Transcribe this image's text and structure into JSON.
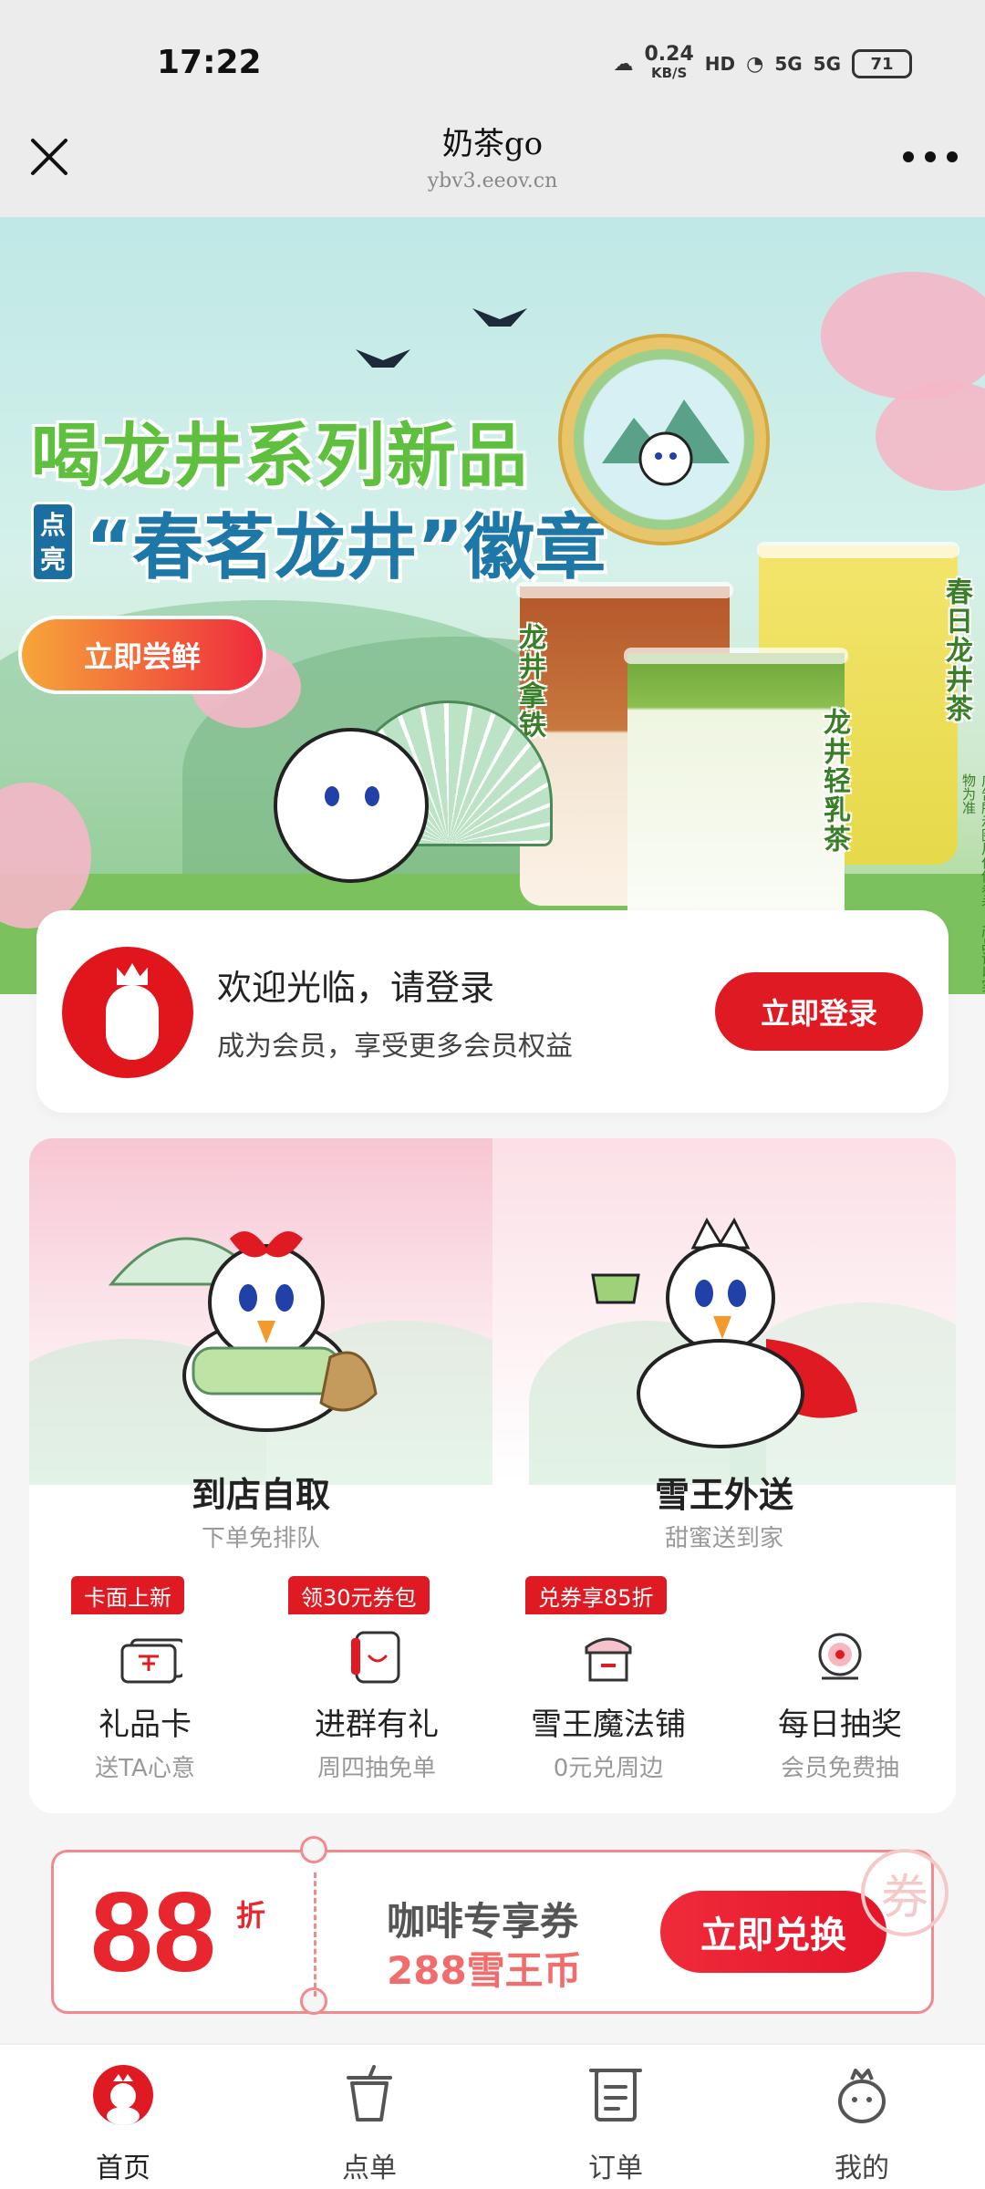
{
  "status_bar": {
    "time": "17:22",
    "net_speed_value": "0.24",
    "net_speed_unit": "KB/S",
    "hd": "HD",
    "signal1": "5G",
    "signal2": "5G",
    "battery": "71"
  },
  "nav": {
    "title": "奶茶go",
    "url": "ybv3.eeov.cn",
    "close_icon": "close-icon",
    "more_icon": "more-icon"
  },
  "banner": {
    "headline_line1": "喝龙井系列新品",
    "headline_tag": "点亮",
    "headline_line2": "“春茗龙井”徽章",
    "cta": "立即尝鲜",
    "drink1": "龙井拿铁",
    "drink2": "龙井轻乳茶",
    "drink3": "春日龙井茶",
    "ad_note": "广告所示图片仅供参考，产品请以实物为准"
  },
  "login": {
    "title": "欢迎光临，请登录",
    "subtitle": "成为会员，享受更多会员权益",
    "button": "立即登录"
  },
  "services": {
    "pickup": {
      "title": "到店自取",
      "subtitle": "下单免排队"
    },
    "delivery": {
      "title": "雪王外送",
      "subtitle": "甜蜜送到家"
    }
  },
  "features": [
    {
      "tag": "卡面上新",
      "label": "礼品卡",
      "sub": "送TA心意",
      "icon": "gift-card-icon"
    },
    {
      "tag": "领30元券包",
      "label": "进群有礼",
      "sub": "周四抽免单",
      "icon": "group-chat-icon"
    },
    {
      "tag": "兑券享85折",
      "label": "雪王魔法铺",
      "sub": "0元兑周边",
      "icon": "shop-icon"
    },
    {
      "tag": "",
      "label": "每日抽奖",
      "sub": "会员免费抽",
      "icon": "lottery-icon"
    }
  ],
  "coupon": {
    "discount": "88",
    "unit": "折",
    "title": "咖啡专享券",
    "cost": "288雪王币",
    "button": "立即兑换",
    "stamp": "券"
  },
  "tabs": [
    {
      "label": "首页",
      "icon": "home-icon"
    },
    {
      "label": "点单",
      "icon": "cup-icon"
    },
    {
      "label": "订单",
      "icon": "order-icon"
    },
    {
      "label": "我的",
      "icon": "profile-icon"
    }
  ],
  "colors": {
    "brand_red": "#e01a22",
    "nav_bg": "#ececec",
    "page_bg": "#f5f5f5"
  }
}
